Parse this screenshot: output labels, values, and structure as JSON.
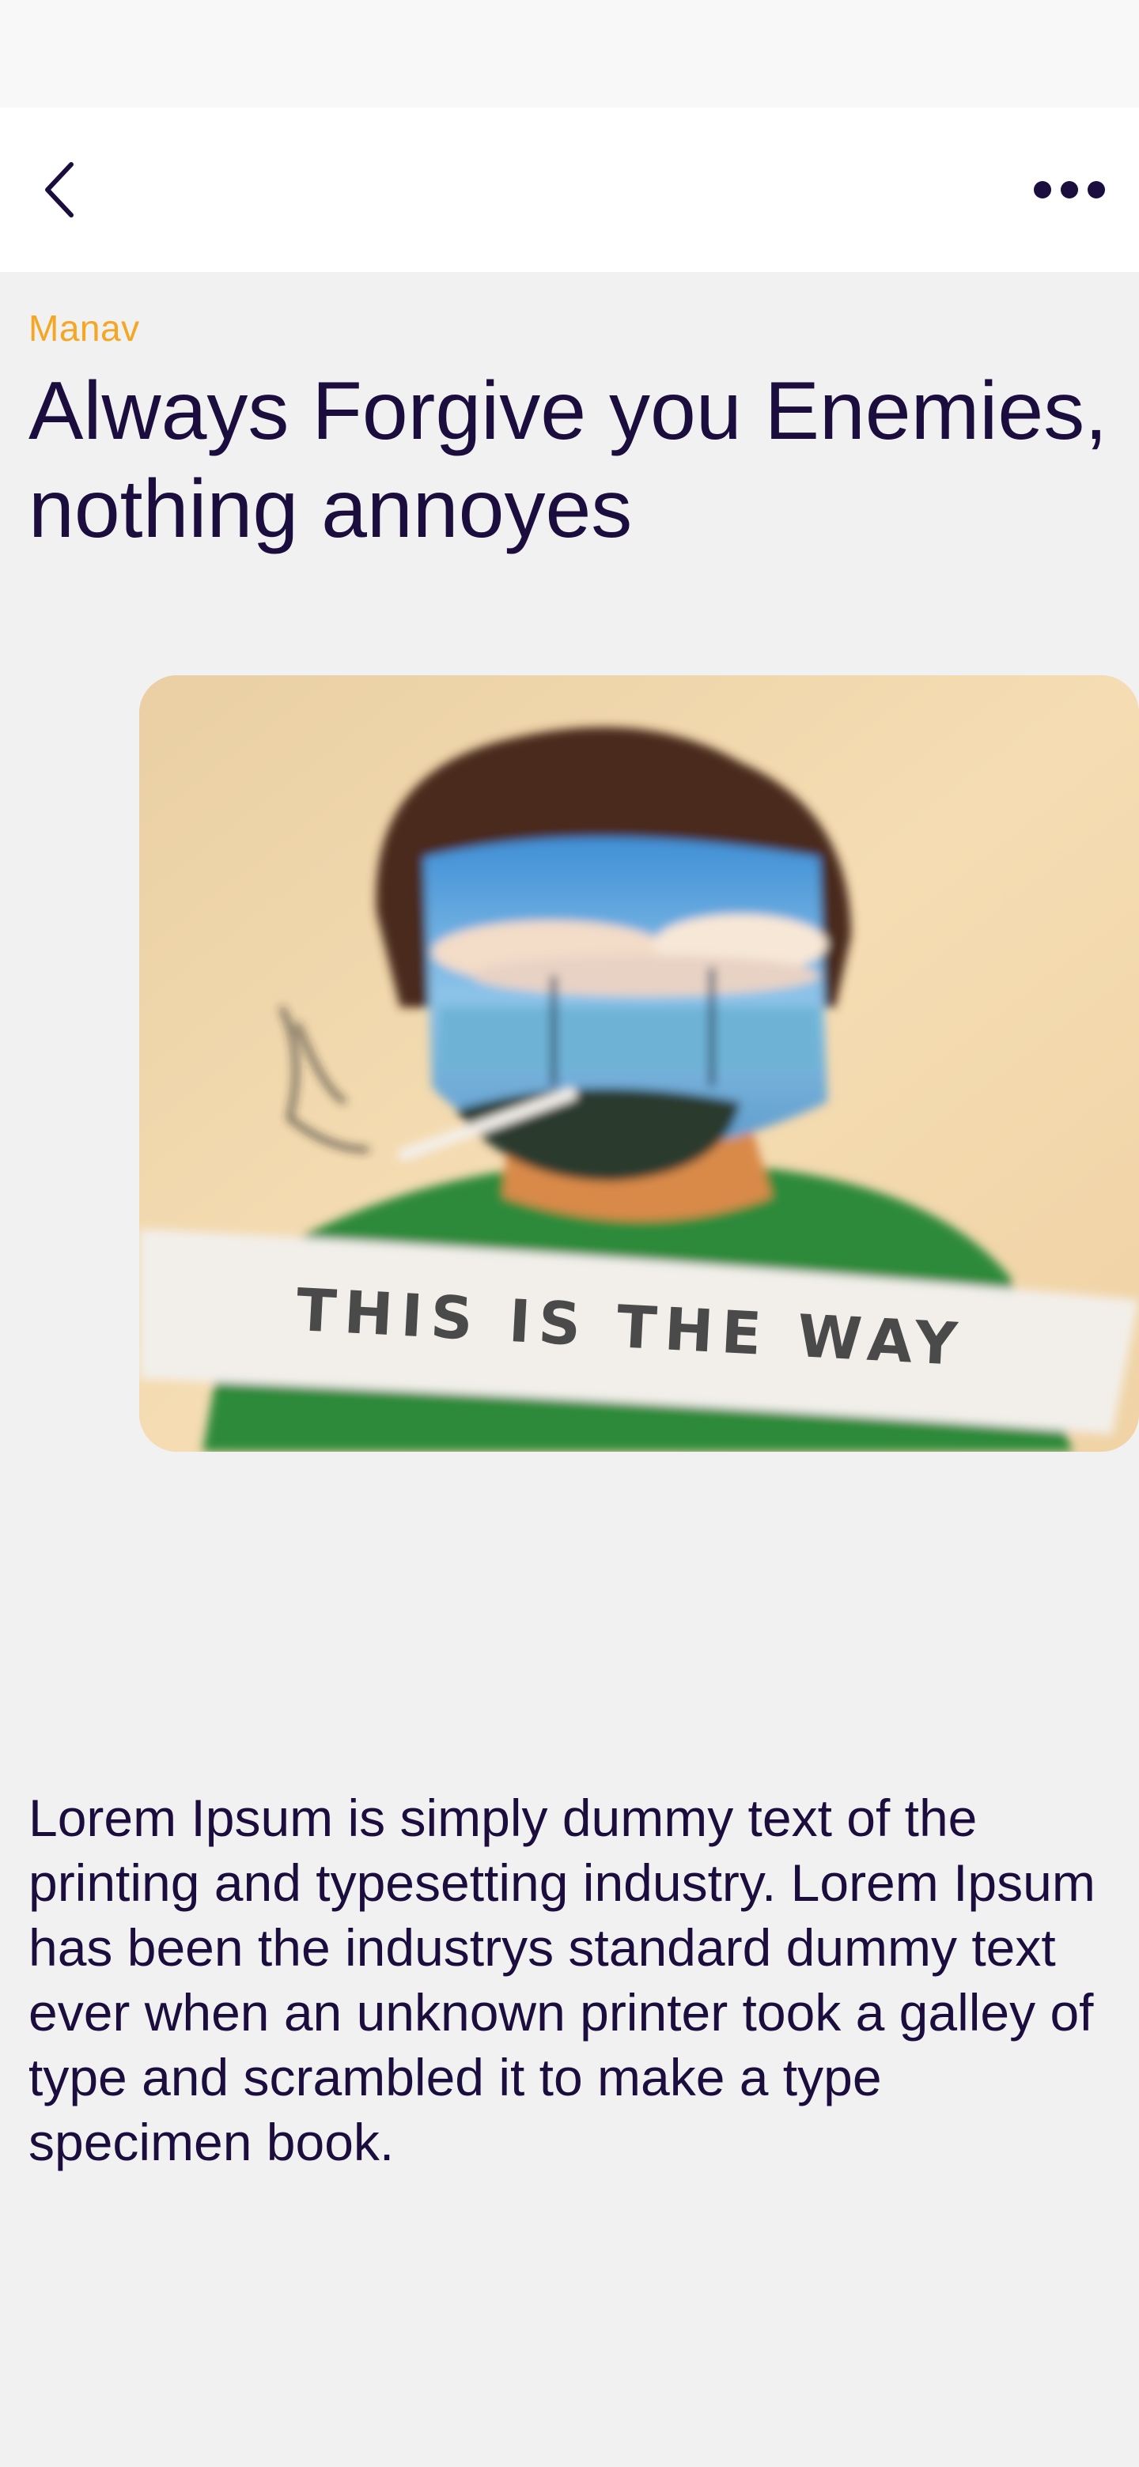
{
  "header": {
    "back_icon": "chevron-left-icon",
    "more_icon": "more-horizontal-icon"
  },
  "article": {
    "author": "Manav",
    "title": "Always Forgive you Enemies, nothing annoyes",
    "image_caption": "THIS IS THE WAY",
    "body": "Lorem Ipsum is simply dummy text of the printing and typesetting industry. Lorem Ipsum has been the industrys standard dummy text ever when an unknown printer took a galley of type and scrambled it to make a type specimen book."
  },
  "colors": {
    "accent": "#f5a623",
    "text": "#1b0d3d",
    "background": "#f1f1f1"
  }
}
